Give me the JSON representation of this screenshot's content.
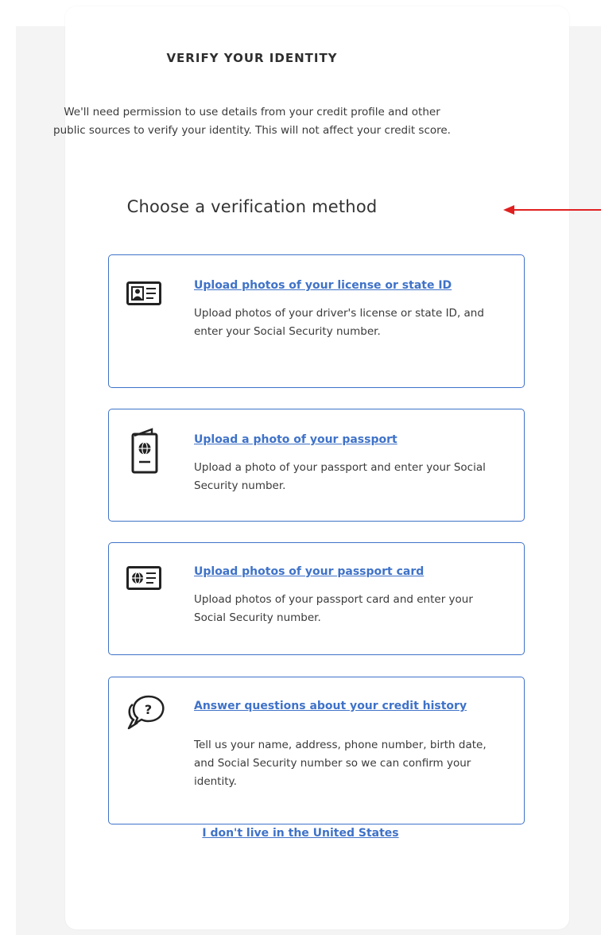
{
  "header": {
    "title": "VERIFY YOUR IDENTITY",
    "intro": "We'll need permission to use details from your credit profile and other public sources to verify your identity. This will not affect your credit score.",
    "subtitle": "Choose a verification method"
  },
  "methods": [
    {
      "icon": "id-card-icon",
      "link": "Upload photos of your license or state ID",
      "description": "Upload photos of your driver's license or state ID, and enter your Social Security number."
    },
    {
      "icon": "passport-icon",
      "link": "Upload a photo of your passport",
      "description": "Upload a photo of your passport and enter your Social Security number."
    },
    {
      "icon": "passport-card-icon",
      "link": "Upload photos of your passport card",
      "description": "Upload photos of your passport card and enter your Social Security number."
    },
    {
      "icon": "chat-question-icon",
      "link": "Answer questions about your credit history",
      "description": "Tell us your name, address, phone number, birth date, and Social Security number so we can confirm your identity."
    }
  ],
  "footer": {
    "link": "I don't live in the United States"
  },
  "colors": {
    "accent": "#3f72c8",
    "annotation_arrow": "#e02020",
    "text": "#3a3a3a"
  }
}
